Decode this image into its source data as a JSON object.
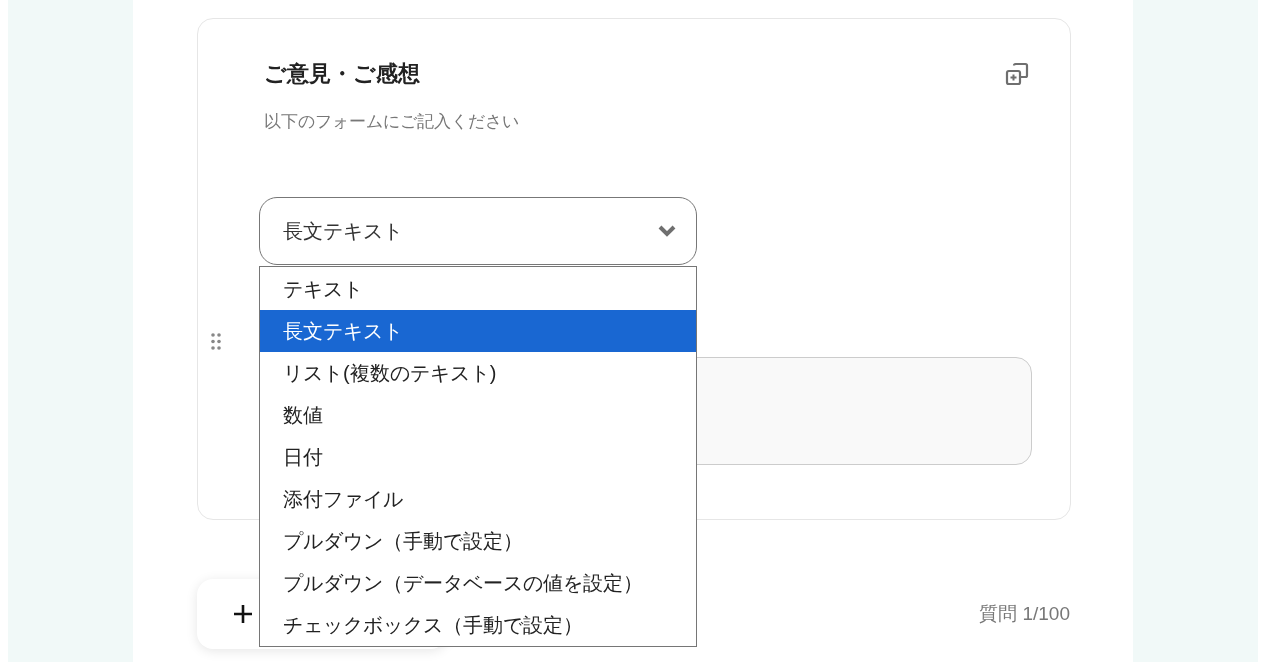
{
  "question": {
    "title": "ご意見・ご感想",
    "description": "以下のフォームにご記入ください"
  },
  "type_select": {
    "value": "長文テキスト",
    "expanded": true,
    "options": [
      {
        "label": "テキスト",
        "selected": false
      },
      {
        "label": "長文テキスト",
        "selected": true
      },
      {
        "label": "リスト(複数のテキスト)",
        "selected": false
      },
      {
        "label": "数値",
        "selected": false
      },
      {
        "label": "日付",
        "selected": false
      },
      {
        "label": "添付ファイル",
        "selected": false
      },
      {
        "label": "プルダウン（手動で設定）",
        "selected": false
      },
      {
        "label": "プルダウン（データベースの値を設定）",
        "selected": false
      },
      {
        "label": "チェックボックス（手動で設定）",
        "selected": false
      }
    ]
  },
  "counter": "質問 1/100"
}
